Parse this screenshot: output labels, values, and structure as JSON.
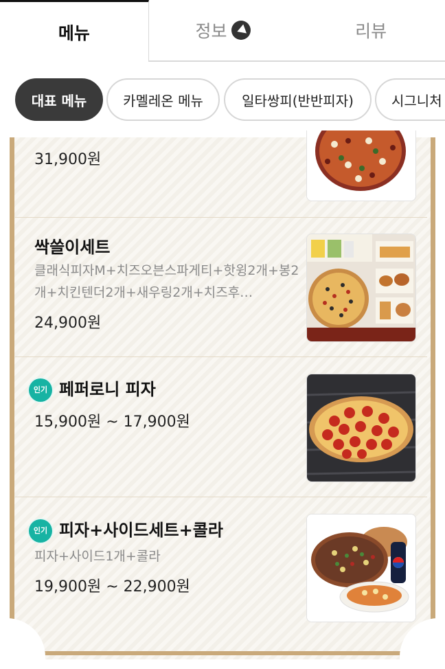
{
  "tabs": [
    {
      "label": "메뉴"
    },
    {
      "label": "정보"
    },
    {
      "label": "리뷰"
    }
  ],
  "chips": [
    {
      "label": "대표 메뉴"
    },
    {
      "label": "카멜레온 메뉴"
    },
    {
      "label": "일타쌍피(반반피자)"
    },
    {
      "label": "시그니처"
    }
  ],
  "items": [
    {
      "name": "",
      "desc": "",
      "price": "31,900원",
      "badge": ""
    },
    {
      "name": "싹쓸이세트",
      "desc": "클래식피자M+치즈오븐스파게티+핫윙2개+봉2개+치킨텐더2개+새우링2개+치즈후…",
      "price": "24,900원",
      "badge": ""
    },
    {
      "name": "페퍼로니 피자",
      "desc": "",
      "price": "15,900원 ~ 17,900원",
      "badge": "인기"
    },
    {
      "name": "피자+사이드세트+콜라",
      "desc": "피자+사이드1개+콜라",
      "price": "19,900원 ~ 22,900원",
      "badge": "인기"
    }
  ]
}
